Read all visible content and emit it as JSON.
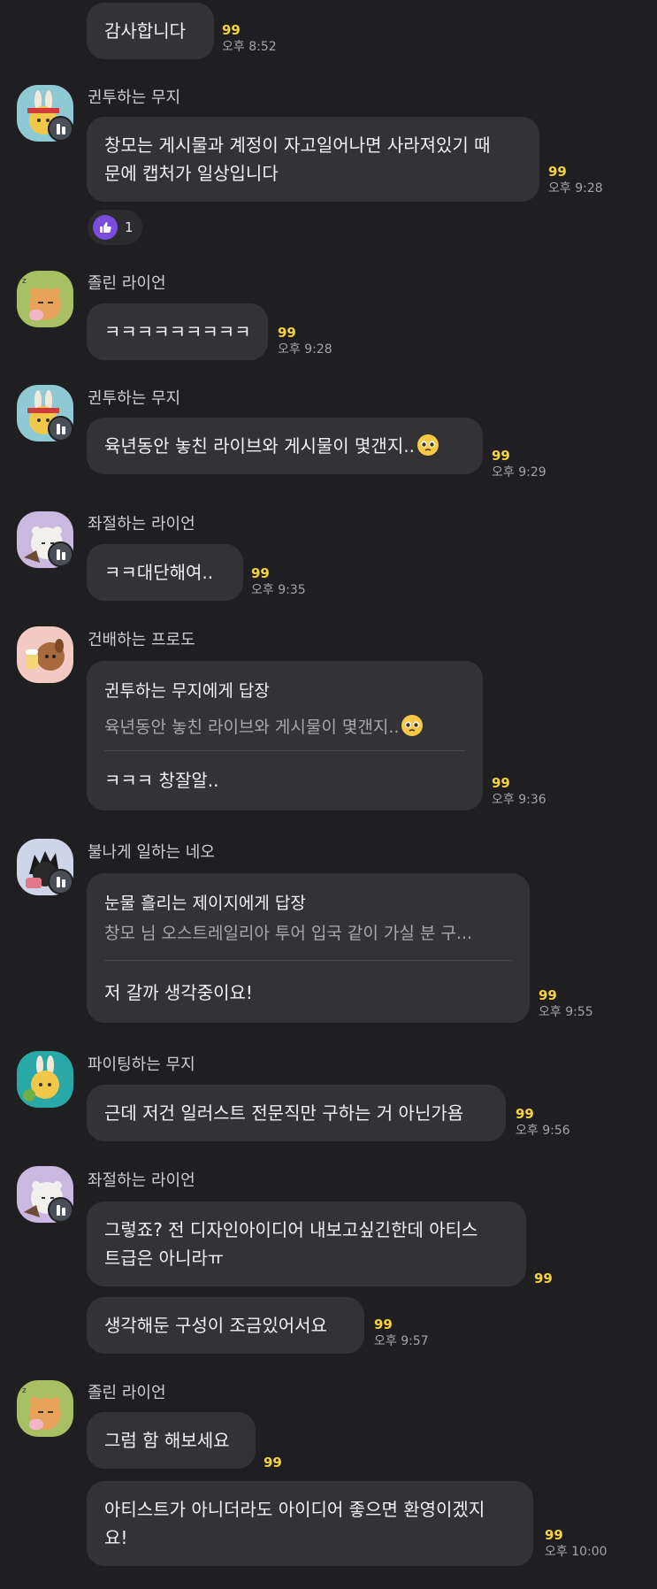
{
  "messages": [
    {
      "id": "m1",
      "text": "감사합니다",
      "unread": "99",
      "time": "오후 8:52"
    },
    {
      "id": "m2",
      "sender": "귄투하는 무지",
      "lines": [
        "창모는 게시물과 계정이 자고일어나면 사라져있기 때",
        "문에 캡처가 일상입니다"
      ],
      "unread": "99",
      "time": "오후 9:28",
      "reaction": {
        "icon": "thumbs-up-icon",
        "count": "1"
      }
    },
    {
      "id": "m3",
      "sender": "졸린 라이언",
      "text": "ㅋㅋㅋㅋㅋㅋㅋㅋㅋ",
      "unread": "99",
      "time": "오후 9:28"
    },
    {
      "id": "m4",
      "sender": "귄투하는 무지",
      "text": "육년동안 놓친 라이브와 게시물이 몇갠지..",
      "unread": "99",
      "time": "오후 9:29",
      "emoji": "pleading-face-icon"
    },
    {
      "id": "m5",
      "sender": "좌절하는 라이언",
      "text": "ㅋㅋ대단해여..",
      "unread": "99",
      "time": "오후 9:35"
    },
    {
      "id": "m6",
      "sender": "건배하는 프로도",
      "reply_to": "귄투하는 무지에게 답장",
      "quote": "육년동안 놓친 라이브와 게시물이 몇갠지..",
      "text": "ㅋㅋㅋ 창잘알..",
      "unread": "99",
      "time": "오후 9:36"
    },
    {
      "id": "m7",
      "sender": "불나게 일하는 네오",
      "reply_to": "눈물 흘리는 제이지에게 답장",
      "quote": "창모 님 오스트레일리아 투어 입국 같이 가실 분 구...",
      "text": "저 갈까 생각중이요!",
      "unread": "99",
      "time": "오후 9:55"
    },
    {
      "id": "m8",
      "sender": "파이팅하는 무지",
      "text": "근데 저건 일러스트 전문직만 구하는 거 아닌가욤",
      "unread": "99",
      "time": "오후 9:56"
    },
    {
      "id": "m9",
      "sender": "좌절하는 라이언",
      "lines": [
        "그렇죠? 전 디자인아이디어 내보고싶긴한데 아티스",
        "트급은 아니라ㅠ"
      ],
      "unread": "99"
    },
    {
      "id": "m10",
      "text": "생각해둔 구성이 조금있어서요",
      "unread": "99",
      "time": "오후 9:57"
    },
    {
      "id": "m11",
      "sender": "졸린 라이언",
      "text": "그럼 함 해보세요",
      "unread": "99"
    },
    {
      "id": "m12",
      "lines": [
        "아티스트가 아니더라도 아이디어 좋으면 환영이겠지",
        "요!"
      ],
      "unread": "99",
      "time": "오후 10:00"
    }
  ],
  "colors": {
    "background": "#1f1f21",
    "bubble": "#333336",
    "unread": "#f6d23e",
    "time": "#a4a4a8",
    "reaction": "#7b4ce0"
  }
}
